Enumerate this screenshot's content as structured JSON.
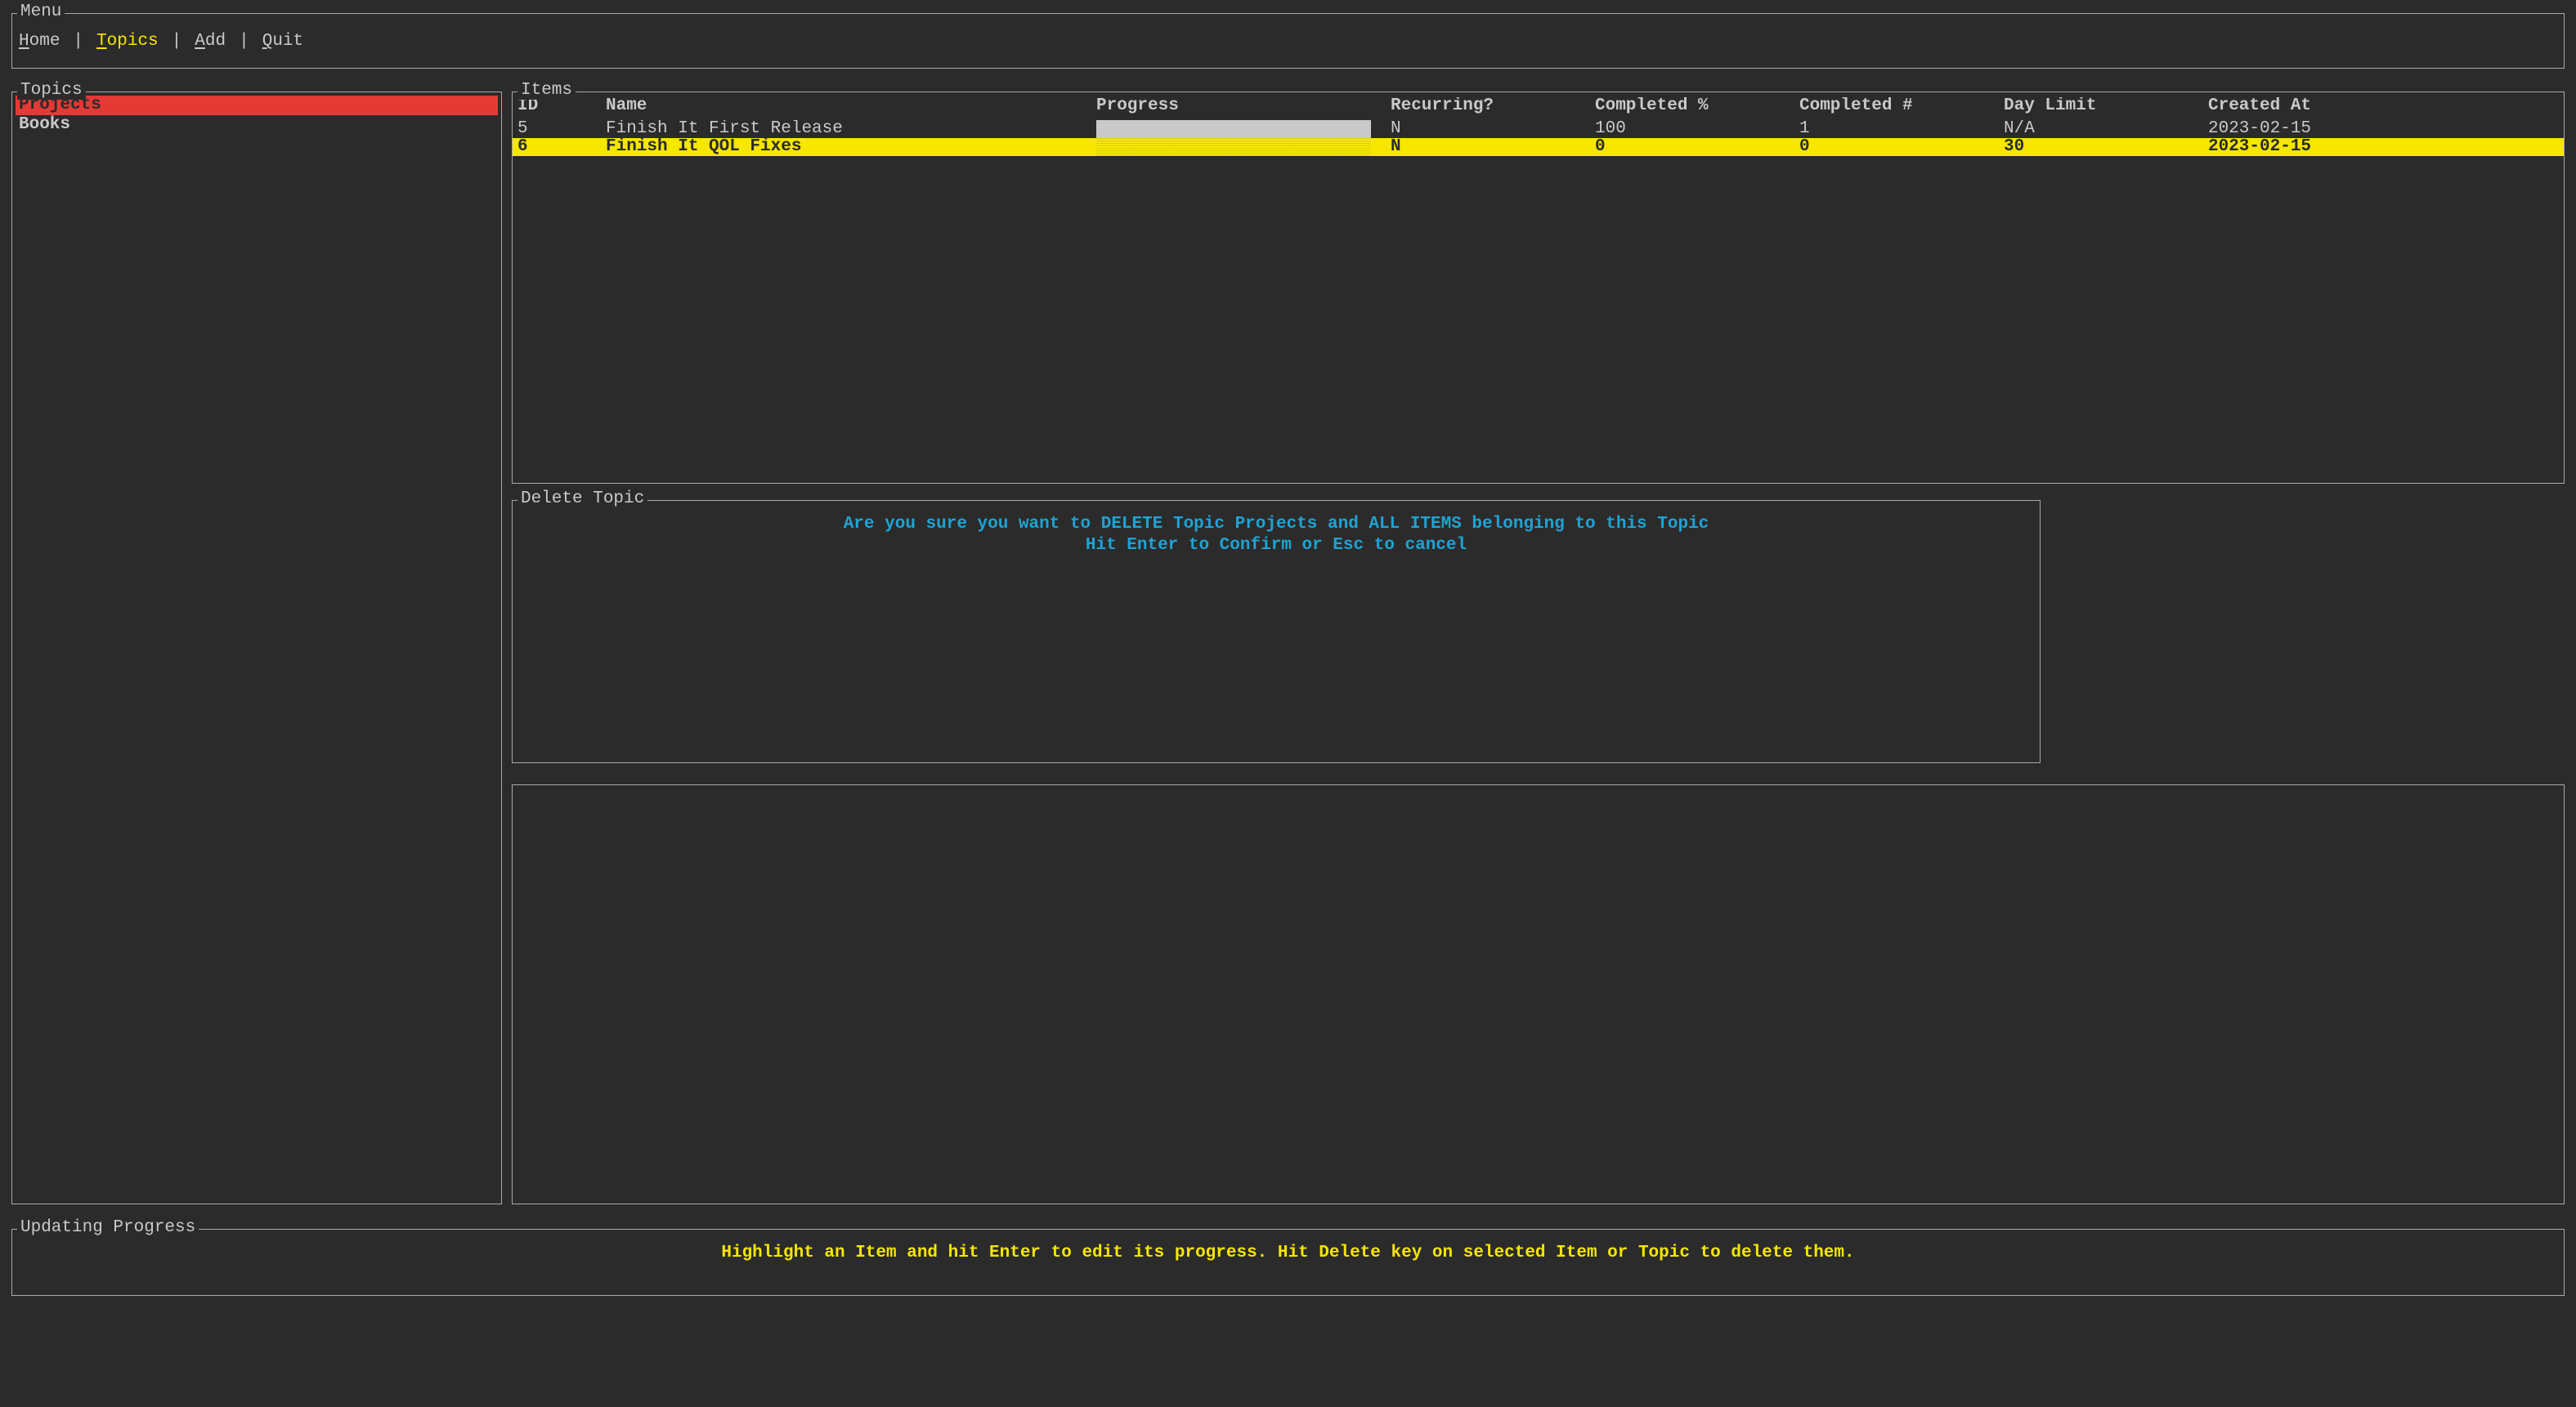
{
  "menu": {
    "title": "Menu",
    "items": [
      {
        "hotkey": "H",
        "rest": "ome",
        "active": false
      },
      {
        "hotkey": "T",
        "rest": "opics",
        "active": true
      },
      {
        "hotkey": "A",
        "rest": "dd",
        "active": false
      },
      {
        "hotkey": "Q",
        "rest": "uit",
        "active": false
      }
    ],
    "separator": "|"
  },
  "topics": {
    "title": "Topics",
    "items": [
      {
        "name": "Projects",
        "selected": true
      },
      {
        "name": "Books",
        "selected": false
      }
    ]
  },
  "items": {
    "title": "Items",
    "headers": {
      "id": "ID",
      "name": "Name",
      "progress": "Progress",
      "recurring": "Recurring?",
      "completed_pct": "Completed %",
      "completed_cnt": "Completed #",
      "day_limit": "Day Limit",
      "created_at": "Created At"
    },
    "rows": [
      {
        "id": "5",
        "name": "Finish It First Release",
        "progress_pct": 100,
        "recurring": "N",
        "completed_pct": "100",
        "completed_cnt": "1",
        "day_limit": "N/A",
        "created_at": "2023-02-15",
        "selected": false
      },
      {
        "id": "6",
        "name": "Finish It QOL Fixes",
        "progress_pct": 0,
        "recurring": "N",
        "completed_pct": "0",
        "completed_cnt": "0",
        "day_limit": "30",
        "created_at": "2023-02-15",
        "selected": true
      }
    ]
  },
  "delete_modal": {
    "title": "Delete Topic",
    "line1": "Are you sure you want to DELETE Topic Projects and ALL ITEMS belonging to this Topic",
    "line2": "Hit Enter to Confirm or Esc to cancel"
  },
  "status": {
    "title": "Updating Progress",
    "text": "Highlight an Item and hit Enter to edit its progress. Hit Delete key on selected Item or Topic to delete them."
  }
}
